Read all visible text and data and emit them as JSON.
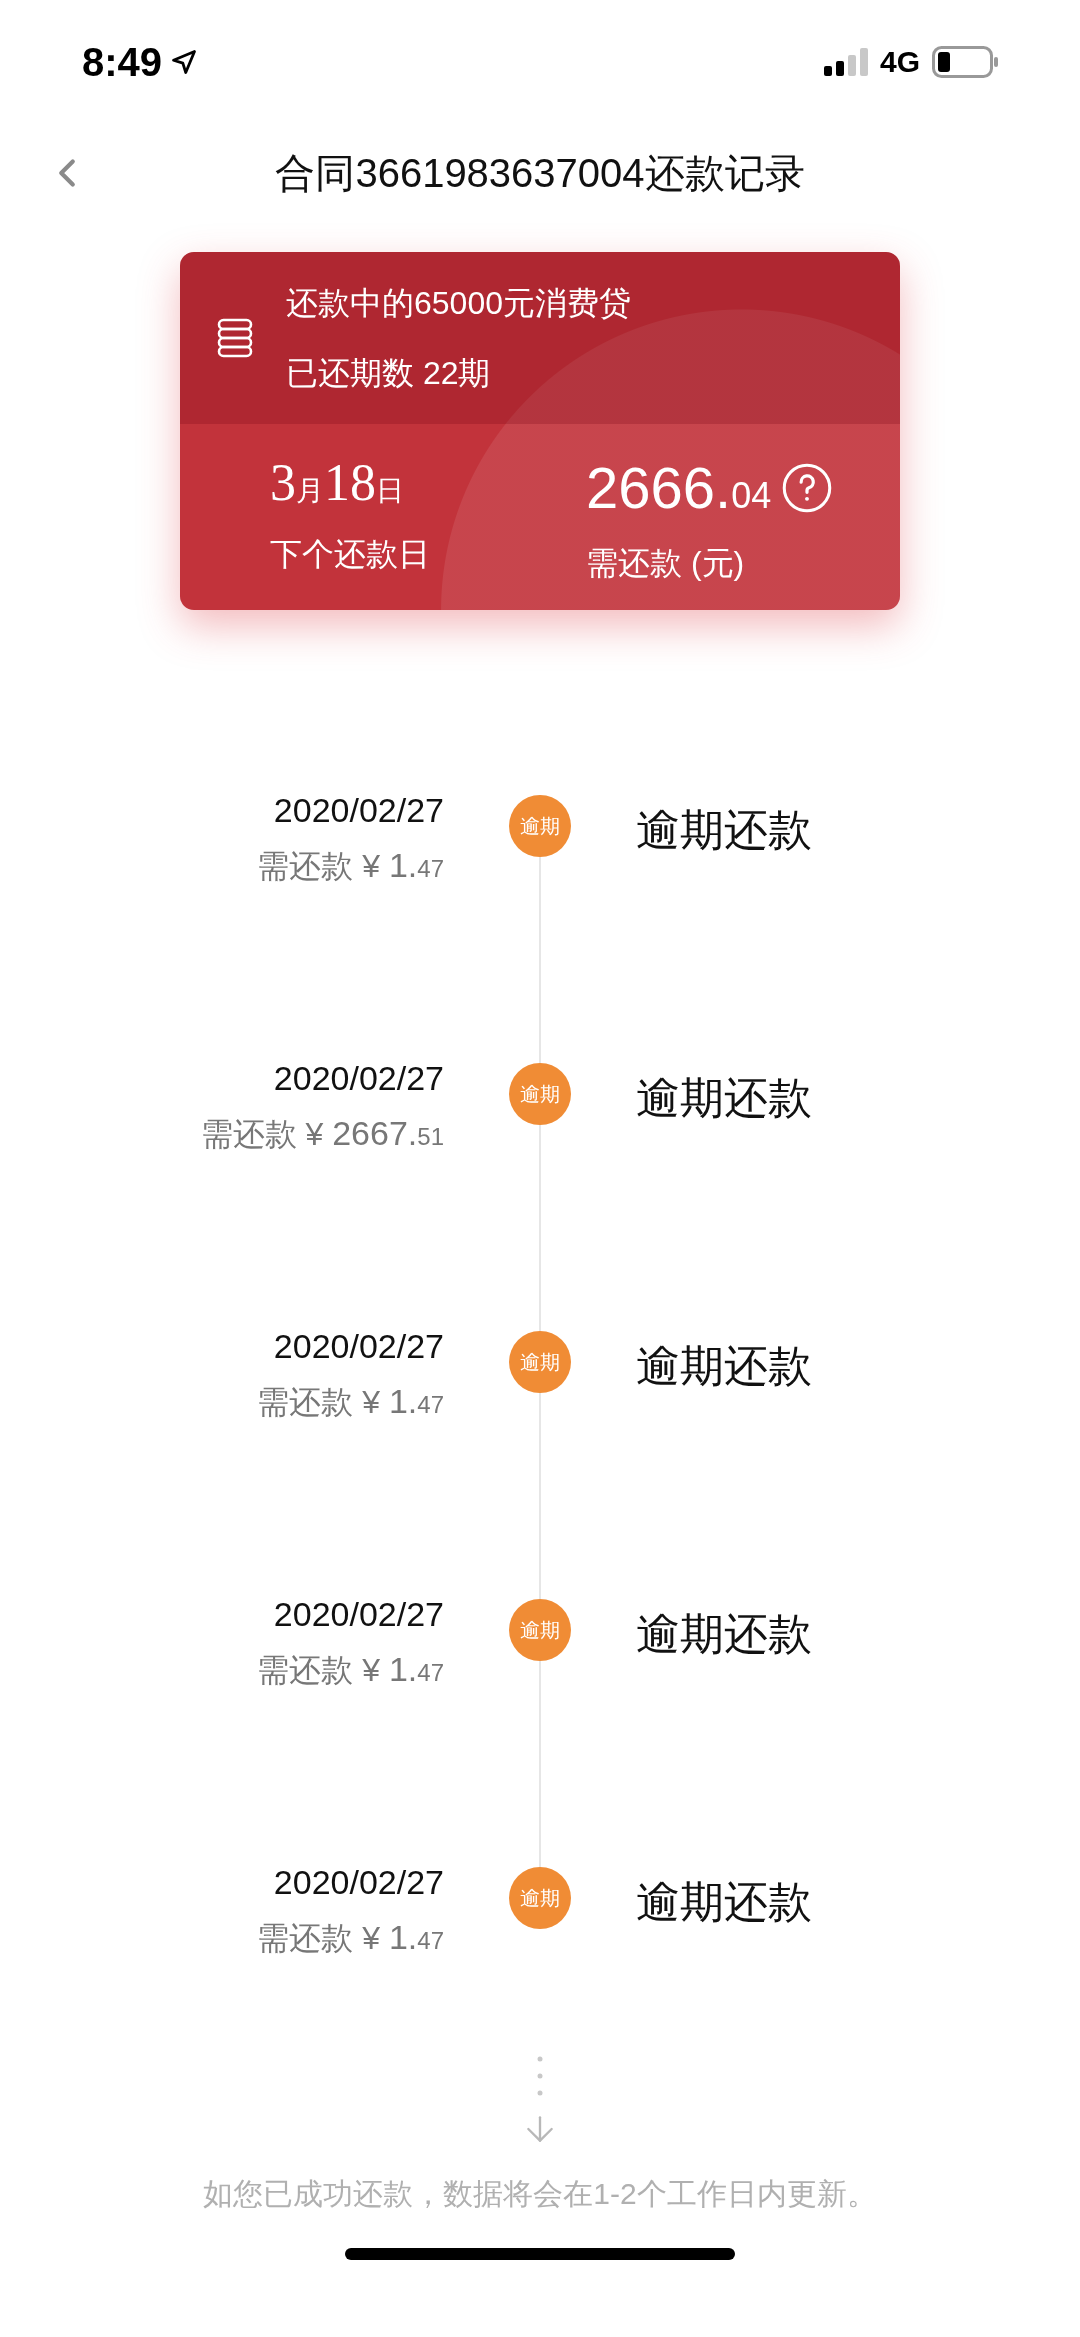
{
  "status_bar": {
    "time": "8:49",
    "network": "4G"
  },
  "nav": {
    "title": "合同3661983637004还款记录"
  },
  "loan_card": {
    "title": "还款中的65000元消费贷",
    "paid_periods": "已还期数 22期",
    "next_date": {
      "month": "3",
      "month_unit": "月",
      "day": "18",
      "day_unit": "日"
    },
    "next_date_label": "下个还款日",
    "amount_whole": "2666.",
    "amount_cents": "04",
    "amount_label": "需还款 (元)"
  },
  "records": [
    {
      "date": "2020/02/27",
      "amount_label": "需还款 ¥",
      "amount_whole": "1.",
      "amount_cents": "47",
      "badge": "逾期",
      "status": "逾期还款"
    },
    {
      "date": "2020/02/27",
      "amount_label": "需还款 ¥",
      "amount_whole": "2667.",
      "amount_cents": "51",
      "badge": "逾期",
      "status": "逾期还款"
    },
    {
      "date": "2020/02/27",
      "amount_label": "需还款 ¥",
      "amount_whole": "1.",
      "amount_cents": "47",
      "badge": "逾期",
      "status": "逾期还款"
    },
    {
      "date": "2020/02/27",
      "amount_label": "需还款 ¥",
      "amount_whole": "1.",
      "amount_cents": "47",
      "badge": "逾期",
      "status": "逾期还款"
    },
    {
      "date": "2020/02/27",
      "amount_label": "需还款 ¥",
      "amount_whole": "1.",
      "amount_cents": "47",
      "badge": "逾期",
      "status": "逾期还款"
    }
  ],
  "footer_note": "如您已成功还款，数据将会在1-2个工作日内更新。"
}
